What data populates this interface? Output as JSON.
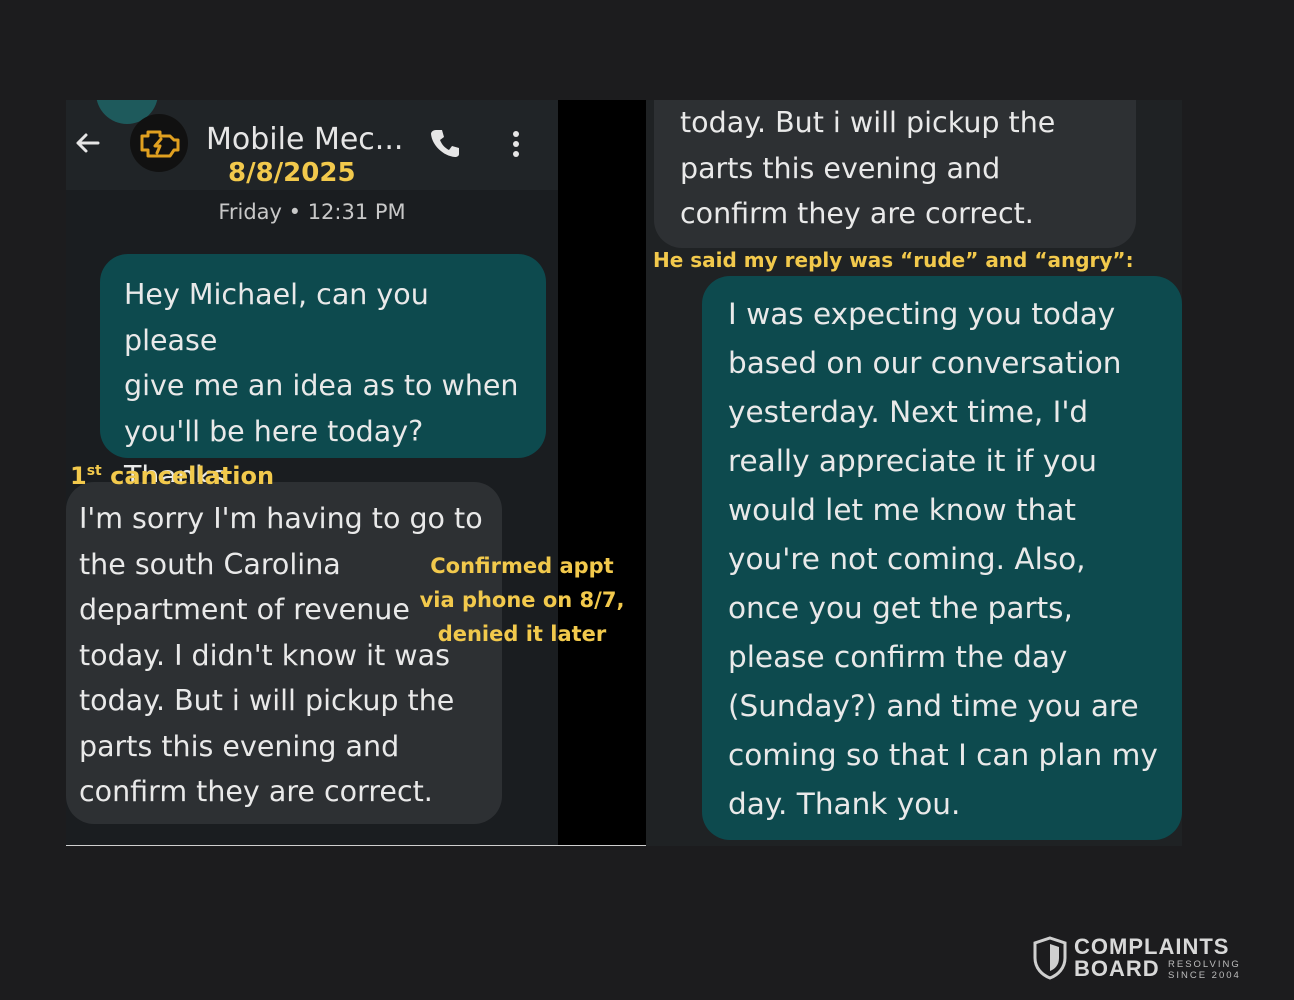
{
  "left_screenshot": {
    "header": {
      "contact_name": "Mobile Mec...",
      "date_annotation": "8/8/2025"
    },
    "timestamp": "Friday • 12:31 PM",
    "messages": [
      {
        "direction": "outgoing",
        "text": "Hey Michael, can you please\ngive me an idea as to when\nyou'll be here today? Thanks,"
      },
      {
        "direction": "incoming",
        "text": "I'm sorry I'm having to go to\nthe south Carolina\ndepartment of revenue\ntoday. I didn't know it was\ntoday.  But i will pickup the\nparts this evening and\nconfirm they are correct."
      }
    ],
    "annotations": {
      "cancellation_number": "1",
      "cancellation_suffix": "st",
      "cancellation_text": " cancellation",
      "confirmed_note": "Confirmed appt\nvia phone on 8/7,\ndenied it later"
    }
  },
  "right_screenshot": {
    "messages": [
      {
        "direction": "incoming",
        "text": "today.  But i will pickup the\nparts this evening and\nconfirm they are correct."
      },
      {
        "direction": "outgoing",
        "text": "I was expecting you today\nbased on our conversation\nyesterday. Next time, I'd\nreally appreciate it if you\nwould let me know that\nyou're not coming. Also,\nonce you get the parts,\nplease confirm the day\n(Sunday?) and time you are\ncoming so that I can plan my\nday. Thank you."
      }
    ],
    "annotation": "He said my reply was “rude” and “angry”:"
  },
  "watermark": {
    "line1": "COMPLAINTS",
    "line2": "BOARD",
    "tagline1": "RESOLVING",
    "tagline2": "SINCE 2004",
    "icon": "shield-icon"
  },
  "colors": {
    "annotation": "#f2c94c",
    "outgoing_bubble": "#0d4a4e",
    "incoming_bubble": "#2d3033",
    "background": "#1c1c1e"
  }
}
